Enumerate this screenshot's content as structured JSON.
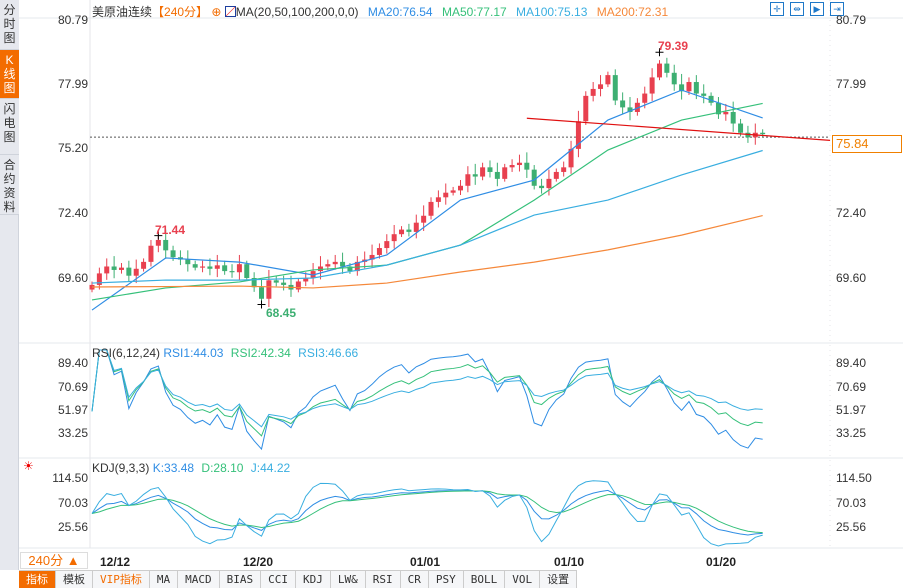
{
  "sidebar": {
    "tabs": [
      "分时图",
      "K线图",
      "闪电图",
      "合约资料"
    ],
    "active": 1
  },
  "header": {
    "symbol": "美原油连续",
    "period": "【240分】",
    "ma_label": "MA(20,50,100,200,0,0)",
    "ma20": "MA20:76.54",
    "ma50": "MA50:77.17",
    "ma100": "MA100:75.13",
    "ma200": "MA200:72.31"
  },
  "rsi": {
    "label": "RSI(6,12,24)",
    "rsi1": "RSI1:44.03",
    "rsi2": "RSI2:42.34",
    "rsi3": "RSI3:46.66",
    "ticks": [
      "89.40",
      "70.69",
      "51.97",
      "33.25"
    ]
  },
  "kdj": {
    "label": "KDJ(9,3,3)",
    "k": "K:33.48",
    "d": "D:28.10",
    "j": "J:44.22",
    "ticks": [
      "114.50",
      "70.03",
      "25.56"
    ]
  },
  "price_ticks": [
    "80.79",
    "77.99",
    "75.20",
    "72.40",
    "69.60"
  ],
  "last_price": "75.84",
  "period_button": "240分 ▲",
  "x_labels": [
    "12/12",
    "12/20",
    "01/01",
    "01/10",
    "01/20"
  ],
  "toolbar": [
    "指标",
    "模板",
    "VIP指标",
    "MA",
    "MACD",
    "BIAS",
    "CCI",
    "KDJ",
    "LW&",
    "RSI",
    "CR",
    "PSY",
    "BOLL",
    "VOL",
    "设置"
  ],
  "colors": {
    "up": "#e8404f",
    "down": "#3daf72",
    "ma20": "#2f8de4",
    "ma50": "#35c07a",
    "ma100": "#39aee0",
    "ma200": "#f5883a",
    "accent": "#f36c00"
  },
  "chart_data": {
    "type": "candlestick",
    "title": "美原油连续 240分",
    "ylim": [
      67.5,
      81.5
    ],
    "x_ticks": {
      "12/12": 3,
      "12/20": 21,
      "01/01": 45,
      "01/10": 64,
      "01/20": 86
    },
    "close": [
      69.3,
      69.8,
      70.1,
      69.95,
      70.05,
      69.7,
      70.0,
      70.3,
      71.0,
      71.25,
      70.8,
      70.5,
      70.4,
      70.2,
      70.05,
      70.1,
      70.0,
      70.15,
      69.9,
      69.85,
      70.2,
      69.6,
      69.2,
      68.7,
      69.5,
      69.4,
      69.3,
      69.1,
      69.45,
      69.6,
      69.9,
      70.1,
      70.2,
      70.3,
      70.1,
      69.9,
      70.3,
      70.4,
      70.6,
      70.9,
      71.2,
      71.5,
      71.7,
      71.6,
      72.0,
      72.3,
      72.9,
      73.1,
      73.3,
      73.4,
      73.6,
      74.1,
      74.0,
      74.4,
      74.2,
      73.9,
      74.4,
      74.5,
      74.6,
      74.3,
      73.6,
      73.5,
      73.9,
      74.2,
      74.4,
      75.2,
      76.4,
      77.5,
      77.8,
      78.0,
      78.4,
      77.3,
      77.0,
      76.8,
      77.2,
      77.6,
      78.3,
      78.9,
      78.5,
      78.0,
      77.7,
      78.1,
      77.6,
      77.5,
      77.2,
      76.7,
      76.8,
      76.3,
      75.9,
      75.7,
      75.9,
      75.84
    ],
    "high_label": {
      "value": "79.39",
      "index": 77
    },
    "low_label": {
      "value": "68.45",
      "index": 23
    },
    "prev_high_label": {
      "value": "71.44",
      "index": 9
    },
    "ma_sample_index": [
      0,
      10,
      20,
      30,
      40,
      50,
      60,
      70,
      80,
      91
    ],
    "ma20": [
      68.21,
      70.47,
      70.29,
      69.73,
      70.6,
      72.98,
      73.85,
      76.45,
      77.75,
      76.54
    ],
    "ma50": [
      68.65,
      69.17,
      69.43,
      69.95,
      70.16,
      71.03,
      72.98,
      75.15,
      76.45,
      77.17
    ],
    "ma100": [
      69.38,
      69.51,
      69.51,
      69.6,
      70.16,
      71.03,
      72.33,
      72.98,
      74.07,
      75.13
    ],
    "ma200": [
      69.21,
      69.23,
      69.25,
      69.17,
      69.38,
      69.86,
      70.29,
      70.82,
      71.46,
      72.31
    ],
    "trendline": {
      "from": {
        "index": 59,
        "price": 76.53
      },
      "to_price": 75.57
    }
  }
}
